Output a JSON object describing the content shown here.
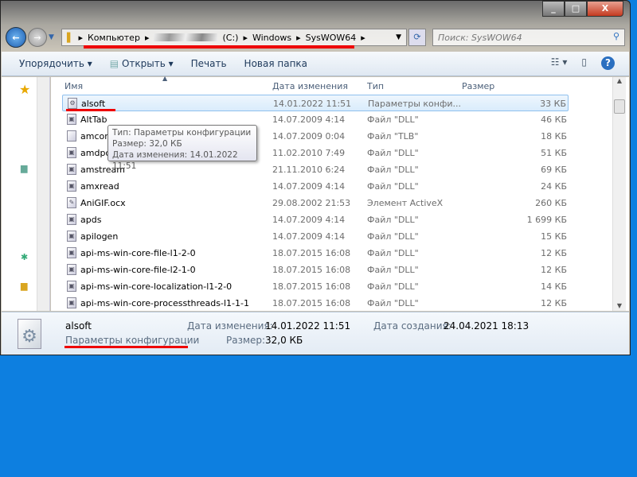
{
  "window": {
    "min": "_",
    "max": "□",
    "close": "X"
  },
  "address": {
    "crumbs": [
      "Компьютер",
      "(C:)",
      "Windows",
      "SysWOW64"
    ]
  },
  "search": {
    "placeholder": "Поиск: SysWOW64"
  },
  "toolbar": {
    "organize": "Упорядочить ▾",
    "open": "Открыть ▾",
    "print": "Печать",
    "new_folder": "Новая папка",
    "views": "☷ ▾",
    "help": "?"
  },
  "columns": {
    "name": "Имя",
    "date": "Дата изменения",
    "type": "Тип",
    "size": "Размер"
  },
  "files": [
    {
      "name": "alsoft",
      "date": "14.01.2022 11:51",
      "type": "Параметры конфи...",
      "size": "33 КБ",
      "icon": "gear-file-icon"
    },
    {
      "name": "AltTab",
      "date": "14.07.2009 4:14",
      "type": "Файл \"DLL\"",
      "size": "46 КБ",
      "icon": "dll-icon"
    },
    {
      "name": "amcompat",
      "date": "14.07.2009 0:04",
      "type": "Файл \"TLB\"",
      "size": "18 КБ",
      "icon": "file-icon"
    },
    {
      "name": "amdpcom",
      "date": "11.02.2010 7:49",
      "type": "Файл \"DLL\"",
      "size": "51 КБ",
      "icon": "dll-icon"
    },
    {
      "name": "amstream",
      "date": "21.11.2010 6:24",
      "type": "Файл \"DLL\"",
      "size": "69 КБ",
      "icon": "dll-icon"
    },
    {
      "name": "amxread",
      "date": "14.07.2009 4:14",
      "type": "Файл \"DLL\"",
      "size": "24 КБ",
      "icon": "dll-icon"
    },
    {
      "name": "AniGIF.ocx",
      "date": "29.08.2002 21:53",
      "type": "Элемент ActiveX",
      "size": "260 КБ",
      "icon": "activex-icon"
    },
    {
      "name": "apds",
      "date": "14.07.2009 4:14",
      "type": "Файл \"DLL\"",
      "size": "1 699 КБ",
      "icon": "dll-icon"
    },
    {
      "name": "apilogen",
      "date": "14.07.2009 4:14",
      "type": "Файл \"DLL\"",
      "size": "15 КБ",
      "icon": "dll-icon"
    },
    {
      "name": "api-ms-win-core-file-l1-2-0",
      "date": "18.07.2015 16:08",
      "type": "Файл \"DLL\"",
      "size": "12 КБ",
      "icon": "dll-icon"
    },
    {
      "name": "api-ms-win-core-file-l2-1-0",
      "date": "18.07.2015 16:08",
      "type": "Файл \"DLL\"",
      "size": "12 КБ",
      "icon": "dll-icon"
    },
    {
      "name": "api-ms-win-core-localization-l1-2-0",
      "date": "18.07.2015 16:08",
      "type": "Файл \"DLL\"",
      "size": "14 КБ",
      "icon": "dll-icon"
    },
    {
      "name": "api-ms-win-core-processthreads-l1-1-1",
      "date": "18.07.2015 16:08",
      "type": "Файл \"DLL\"",
      "size": "12 КБ",
      "icon": "dll-icon"
    }
  ],
  "tooltip": {
    "line1": "Тип: Параметры конфигурации",
    "line2": "Размер: 32,0 КБ",
    "line3": "Дата изменения: 14.01.2022 11:51"
  },
  "details": {
    "name": "alsoft",
    "type": "Параметры конфигурации",
    "modified_label": "Дата изменения:",
    "modified": "14.01.2022 11:51",
    "created_label": "Дата создания:",
    "created": "24.04.2021 18:13",
    "size_label": "Размер:",
    "size": "32,0 КБ"
  }
}
